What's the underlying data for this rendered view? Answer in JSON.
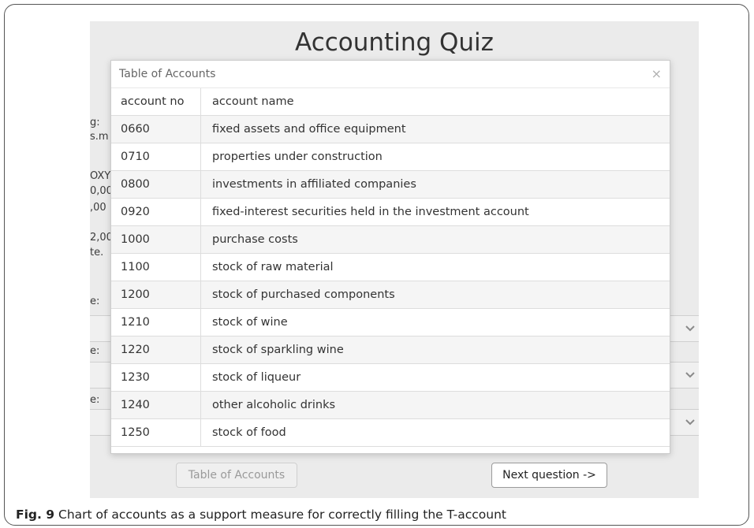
{
  "app": {
    "title": "Accounting Quiz",
    "background_fragments": [
      "g:",
      "s.m",
      "OXY",
      "0,00",
      ",00 ",
      "2,00",
      "te.",
      "e:",
      "e:",
      "e:"
    ]
  },
  "modal": {
    "title": "Table of Accounts",
    "close_glyph": "×",
    "columns": [
      "account no",
      "account name"
    ],
    "rows": [
      {
        "no": "0660",
        "name": "fixed assets and office equipment"
      },
      {
        "no": "0710",
        "name": "properties under construction"
      },
      {
        "no": "0800",
        "name": "investments in affiliated companies"
      },
      {
        "no": "0920",
        "name": "fixed-interest securities held in the investment account"
      },
      {
        "no": "1000",
        "name": "purchase costs"
      },
      {
        "no": "1100",
        "name": "stock of raw material"
      },
      {
        "no": "1200",
        "name": "stock of purchased components"
      },
      {
        "no": "1210",
        "name": "stock of wine"
      },
      {
        "no": "1220",
        "name": "stock of sparkling wine"
      },
      {
        "no": "1230",
        "name": "stock of liqueur"
      },
      {
        "no": "1240",
        "name": "other alcoholic drinks"
      },
      {
        "no": "1250",
        "name": "stock of food"
      }
    ]
  },
  "buttons": {
    "table_of_accounts": "Table of Accounts",
    "next_question": "Next question ->"
  },
  "caption": {
    "label": "Fig. 9",
    "text": "Chart of accounts as a support measure for correctly filling the T-account"
  },
  "icons": {
    "dropdown": "chevron-down-icon",
    "close": "close-icon"
  }
}
